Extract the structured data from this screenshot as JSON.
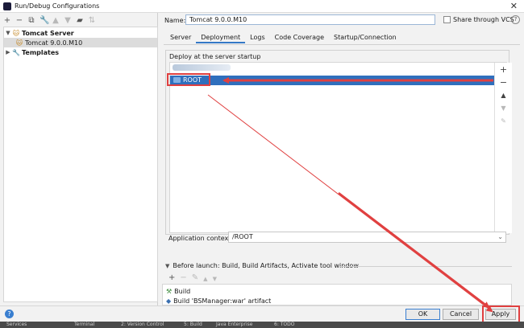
{
  "window": {
    "title": "Run/Debug Configurations",
    "close_glyph": "✕"
  },
  "left_toolbar": [
    {
      "name": "add-icon",
      "glyph": "+"
    },
    {
      "name": "remove-icon",
      "glyph": "−"
    },
    {
      "name": "copy-icon",
      "glyph": "⧉"
    },
    {
      "name": "wrench-icon",
      "glyph": "🔧"
    },
    {
      "name": "move-up-icon",
      "glyph": "▲"
    },
    {
      "name": "move-down-icon",
      "glyph": "▼"
    },
    {
      "name": "folder-icon",
      "glyph": "▰"
    },
    {
      "name": "sort-icon",
      "glyph": "⇅"
    }
  ],
  "tree": {
    "tomcat_server": "Tomcat Server",
    "tomcat_config": "Tomcat 9.0.0.M10",
    "templates": "Templates"
  },
  "config": {
    "name_label": "Name:",
    "name_value": "Tomcat 9.0.0.M10",
    "share_label": "Share through VCS",
    "help": "?"
  },
  "tabs": [
    "Server",
    "Deployment",
    "Logs",
    "Code Coverage",
    "Startup/Connection"
  ],
  "deployment": {
    "section_title": "Deploy at the server startup",
    "root_item": "ROOT",
    "context_label": "Application context:",
    "context_value": "/ROOT"
  },
  "before_launch": {
    "title": "Before launch: Build, Build Artifacts, Activate tool window",
    "items": [
      "Build",
      "Build 'BSManager:war' artifact"
    ]
  },
  "buttons": {
    "ok": "OK",
    "cancel": "Cancel",
    "apply": "Apply",
    "help": "?"
  },
  "statusbar": [
    "Services",
    "Terminal",
    "2: Version Control",
    "5: Build",
    "Java Enterprise",
    "6: TODO"
  ],
  "colors": {
    "selection": "#2f6fbd",
    "annotation": "#e04040",
    "accent": "#3478c6"
  }
}
